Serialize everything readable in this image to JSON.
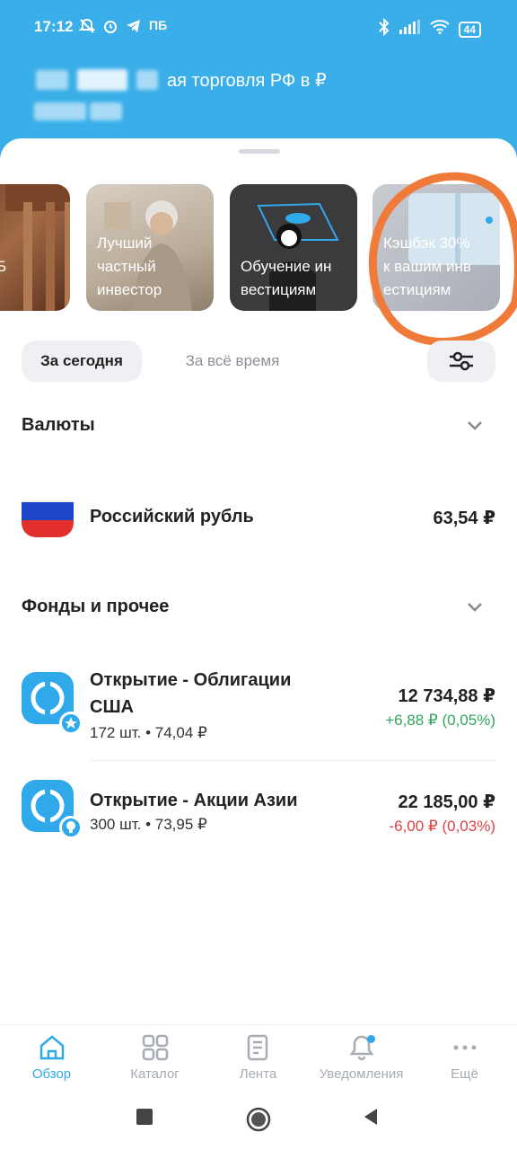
{
  "status_bar": {
    "time": "17:12",
    "carrier_badge": "ПБ",
    "battery": "44"
  },
  "header": {
    "title_visible_part": "ая торговля РФ в ₽"
  },
  "stories": [
    {
      "text": "на СПБ\nе"
    },
    {
      "text": "Лучший\nчастный\nинвестор"
    },
    {
      "text": "Обучение ин\nвестициям"
    },
    {
      "text": "Кэшбэк 30%\nк вашим инв\nестициям"
    }
  ],
  "period_tabs": {
    "today": "За сегодня",
    "all_time": "За всё время"
  },
  "currencies": {
    "title": "Валюты",
    "items": [
      {
        "name": "Российский рубль",
        "value": "63,54 ₽"
      }
    ]
  },
  "funds": {
    "title": "Фонды и прочее",
    "items": [
      {
        "name_line1": "Открытие - Облигации",
        "name_line2": "США",
        "details": "172 шт. • 74,04 ₽",
        "value": "12 734,88 ₽",
        "change": "+6,88 ₽ (0,05%)"
      },
      {
        "name_line1": "Открытие - Акции Азии",
        "details": "300 шт. • 73,95 ₽",
        "value": "22 185,00 ₽",
        "change": "-6,00 ₽ (0,03%)"
      }
    ]
  },
  "bottom_nav": {
    "overview": "Обзор",
    "catalog": "Каталог",
    "feed": "Лента",
    "notifications": "Уведомления",
    "more": "Ещё"
  },
  "colors": {
    "brand_blue": "#3AAEE8",
    "accent_blue": "#2FA9EA",
    "positive": "#2EA75A",
    "negative": "#E04040",
    "annotation": "#F07A3A"
  }
}
